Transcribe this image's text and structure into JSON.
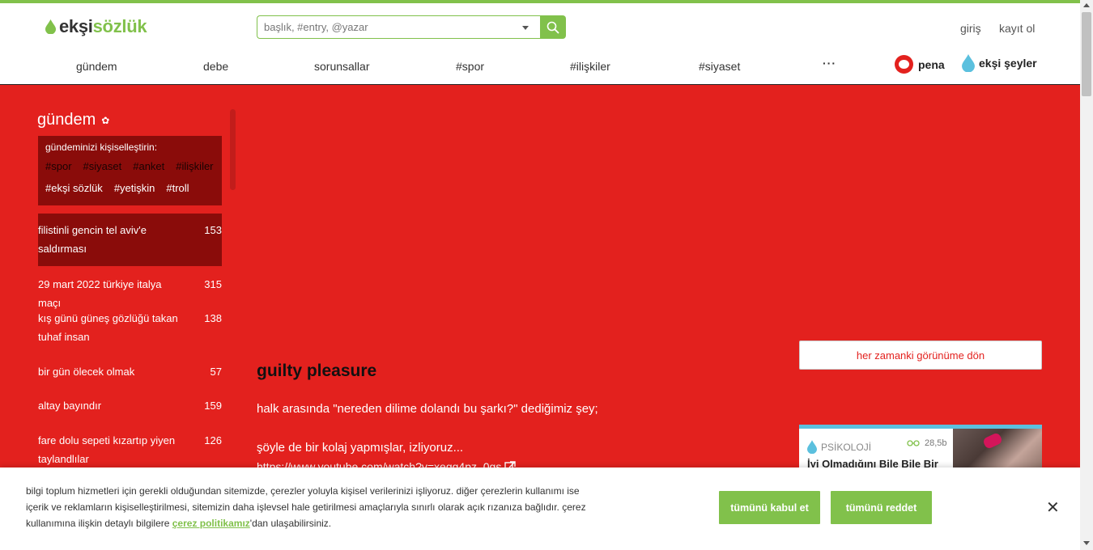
{
  "header": {
    "logo_part1": "ekşi",
    "logo_part2": "sözlük",
    "search_placeholder": "başlık, #entry, @yazar",
    "login": "giriş",
    "register": "kayıt ol",
    "nav": [
      "gündem",
      "debe",
      "sorunsallar",
      "#spor",
      "#ilişkiler",
      "#siyaset"
    ],
    "more": "···",
    "pena": "pena",
    "seyler": "ekşi şeyler"
  },
  "sidebar": {
    "title": "gündem",
    "personalize_title": "gündeminizi kişiselleştirin:",
    "tags_dim": [
      "#spor",
      "#siyaset",
      "#anket",
      "#ilişkiler"
    ],
    "tags_bright": [
      "#ekşi sözlük",
      "#yetişkin",
      "#troll"
    ],
    "topics": [
      {
        "title": "filistinli gencin tel aviv'e saldırması",
        "count": "153"
      },
      {
        "title": "29 mart 2022 türkiye italya maçı",
        "count": "315"
      },
      {
        "title": "kış günü güneş gözlüğü takan tuhaf insan",
        "count": "138"
      },
      {
        "title": "bir gün ölecek olmak",
        "count": "57"
      },
      {
        "title": "altay bayındır",
        "count": "159"
      },
      {
        "title": "fare dolu sepeti kızartıp yiyen taylandlılar",
        "count": "126"
      }
    ]
  },
  "entry": {
    "title": "guilty pleasure",
    "line1": "halk arasında \"nereden dilime dolandı bu şarkı?\" dediğimiz şey;",
    "line2": "şöyle de bir kolaj yapmışlar, izliyoruz...",
    "link": "https://www.youtube.com/watch?v=xegg4pz_0gs"
  },
  "right": {
    "view_button": "her zamanki görünüme dön",
    "promo_category": "PSİKOLOJİ",
    "promo_views": "28,5b",
    "promo_title": "İyi Olmadığını Bile Bile Bir"
  },
  "cookie": {
    "text_before": "bilgi toplum hizmetleri için gerekli olduğundan sitemizde, çerezler yoluyla kişisel verilerinizi işliyoruz. diğer çerezlerin kullanımı ise içerik ve reklamların kişiselleştirilmesi, sitemizin daha işlevsel hale getirilmesi amaçlarıyla sınırlı olarak açık rızanıza bağlıdır. çerez kullanımına ilişkin detaylı bilgilere ",
    "link": "çerez politikamız",
    "text_after": "'dan ulaşabilirsiniz.",
    "accept": "tümünü kabul et",
    "reject": "tümünü reddet",
    "close": "✕"
  },
  "colors": {
    "brand_green": "#81c14b",
    "background_red": "#e3211e",
    "dark_red": "#8a0c0a",
    "promo_blue": "#5bc0de"
  },
  "icons": [
    "drop-icon",
    "search-icon",
    "gear-icon",
    "pena-icon",
    "external-link-icon",
    "glasses-icon",
    "close-icon"
  ]
}
